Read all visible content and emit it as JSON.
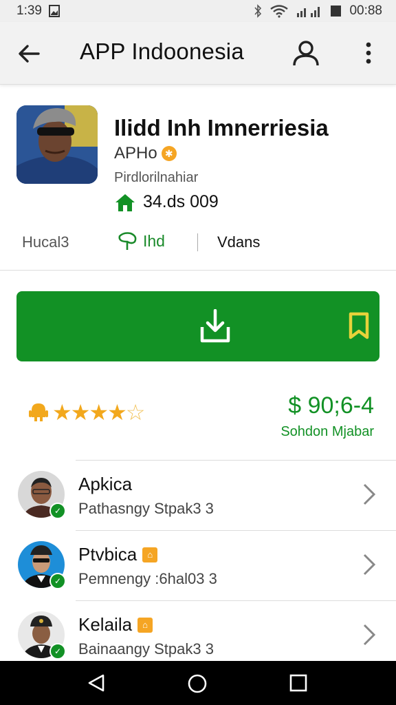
{
  "status_bar": {
    "time": "1:39",
    "clock_right": "00:88",
    "icons": [
      "image-icon",
      "bluetooth-icon",
      "wifi-icon",
      "signal-icon",
      "battery-icon"
    ]
  },
  "app_bar": {
    "title": "APP Indoonesia",
    "icons": [
      "back-arrow-icon",
      "account-icon",
      "more-vert-icon"
    ]
  },
  "app": {
    "name": "Ilidd Inh Imnerriesia",
    "developer": "APHo",
    "category": "Pirdlorilnahiar",
    "count": "34.ds 009",
    "tabs": [
      "Hucal3",
      "Ihd",
      "Vdans"
    ]
  },
  "rating": {
    "stars": 4.5,
    "price": "$ 90;6-4",
    "price_sub": "Sohdon Mjabar"
  },
  "list": [
    {
      "name": "Apkica",
      "sub": "Pathasngy Stpak3 3",
      "badge": false
    },
    {
      "name": "Ptvbica",
      "sub": "Pemnengy :6hal03 3",
      "badge": true
    },
    {
      "name": "Kelaila",
      "sub": "Bainaangy Stpak3 3",
      "badge": true
    }
  ],
  "colors": {
    "accent": "#129125",
    "badge": "#f5a524",
    "star": "#f2a81d"
  }
}
